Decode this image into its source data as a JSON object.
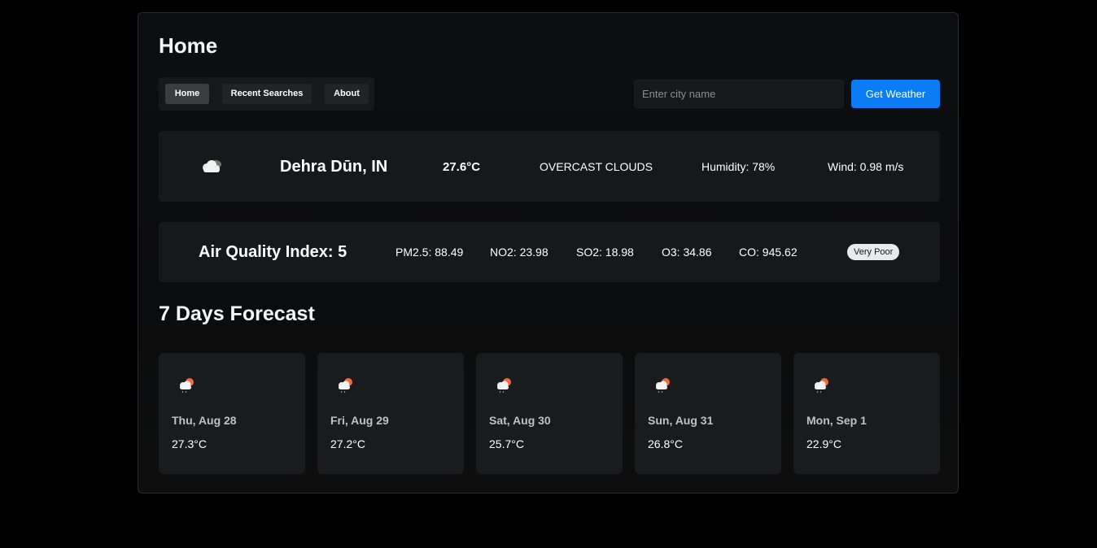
{
  "page": {
    "title": "Home"
  },
  "nav": {
    "items": [
      {
        "label": "Home",
        "active": true
      },
      {
        "label": "Recent Searches",
        "active": false
      },
      {
        "label": "About",
        "active": false
      }
    ]
  },
  "search": {
    "placeholder": "Enter city name",
    "value": "",
    "button_label": "Get Weather"
  },
  "current_weather": {
    "icon": "overcast-clouds-icon",
    "city": "Dehra Dūn, IN",
    "temperature": "27.6°C",
    "description": "OVERCAST CLOUDS",
    "humidity": "Humidity: 78%",
    "wind": "Wind: 0.98 m/s"
  },
  "air_quality": {
    "title": "Air Quality Index: 5",
    "pm25": "PM2.5: 88.49",
    "no2": "NO2: 23.98",
    "so2": "SO2: 18.98",
    "o3": "O3: 34.86",
    "co": "CO: 945.62",
    "status": "Very Poor"
  },
  "forecast": {
    "title": "7 Days Forecast",
    "days": [
      {
        "day": "Thu, Aug 28",
        "temp": "27.3°C",
        "icon": "rain-sun-cloud-icon"
      },
      {
        "day": "Fri, Aug 29",
        "temp": "27.2°C",
        "icon": "rain-sun-cloud-icon"
      },
      {
        "day": "Sat, Aug 30",
        "temp": "25.7°C",
        "icon": "rain-sun-cloud-icon"
      },
      {
        "day": "Sun, Aug 31",
        "temp": "26.8°C",
        "icon": "rain-sun-cloud-icon"
      },
      {
        "day": "Mon, Sep 1",
        "temp": "22.9°C",
        "icon": "rain-sun-cloud-icon"
      }
    ]
  },
  "colors": {
    "accent": "#0b7cf5",
    "background": "#000000",
    "card": "#16181b",
    "sun": "#f06a3c"
  }
}
